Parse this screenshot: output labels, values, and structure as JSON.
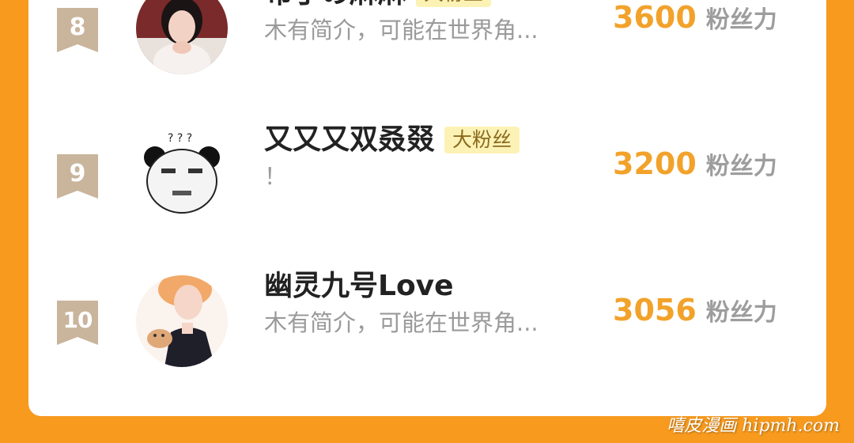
{
  "ranking": {
    "rows": [
      {
        "rank": "8",
        "name": "布丁の麻麻",
        "badge": "大粉丝",
        "bio": "木有简介，可能在世界角...",
        "score": "3600",
        "score_unit": "粉丝力"
      },
      {
        "rank": "9",
        "name": "又又又双叒叕",
        "badge": "大粉丝",
        "bio": "！",
        "score": "3200",
        "score_unit": "粉丝力"
      },
      {
        "rank": "10",
        "name": "幽灵九号Love",
        "badge": "",
        "bio": "木有简介，可能在世界角...",
        "score": "3056",
        "score_unit": "粉丝力"
      }
    ]
  },
  "watermark": "嘻皮漫画 hipmh.com",
  "colors": {
    "background": "#f79a1e",
    "card": "#ffffff",
    "score": "#f2a22a",
    "badge_bg": "#fdf2b6",
    "rank_badge": "#c9b49c"
  }
}
